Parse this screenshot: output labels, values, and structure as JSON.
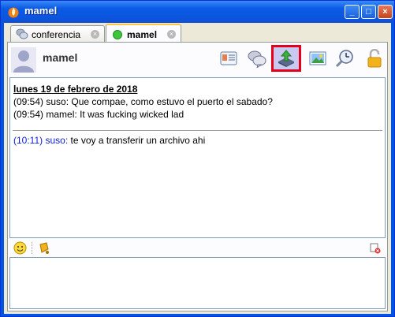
{
  "window": {
    "title": "mamel"
  },
  "window_buttons": {
    "minimize": "_",
    "maximize": "□",
    "close": "×"
  },
  "tabs": [
    {
      "label": "conferencia",
      "close": "×"
    },
    {
      "label": "mamel",
      "close": "×"
    }
  ],
  "contact": {
    "name": "mamel"
  },
  "toolbar": [
    {
      "icon": "vcard-icon"
    },
    {
      "icon": "conference-icon"
    },
    {
      "icon": "send-file-icon",
      "selected": true
    },
    {
      "icon": "picture-icon"
    },
    {
      "icon": "history-icon"
    },
    {
      "icon": "unlocked-padlock-icon"
    }
  ],
  "chat": {
    "date": "lunes 19 de febrero de 2018",
    "messages": [
      {
        "time": "(09:54)",
        "sender": "suso:",
        "text": "Que compae, como estuvo el puerto el sabado?"
      },
      {
        "time": "(09:54)",
        "sender": "mamel:",
        "text": "It was fucking wicked lad"
      }
    ],
    "after_separator": [
      {
        "time": "(10:11)",
        "sender": "suso:",
        "text": "te voy a transferir un archivo ahi"
      }
    ]
  },
  "colors": {
    "titlebar": "#0b56df",
    "selected_highlight": "#e2001a",
    "system_message": "#1020d0"
  }
}
